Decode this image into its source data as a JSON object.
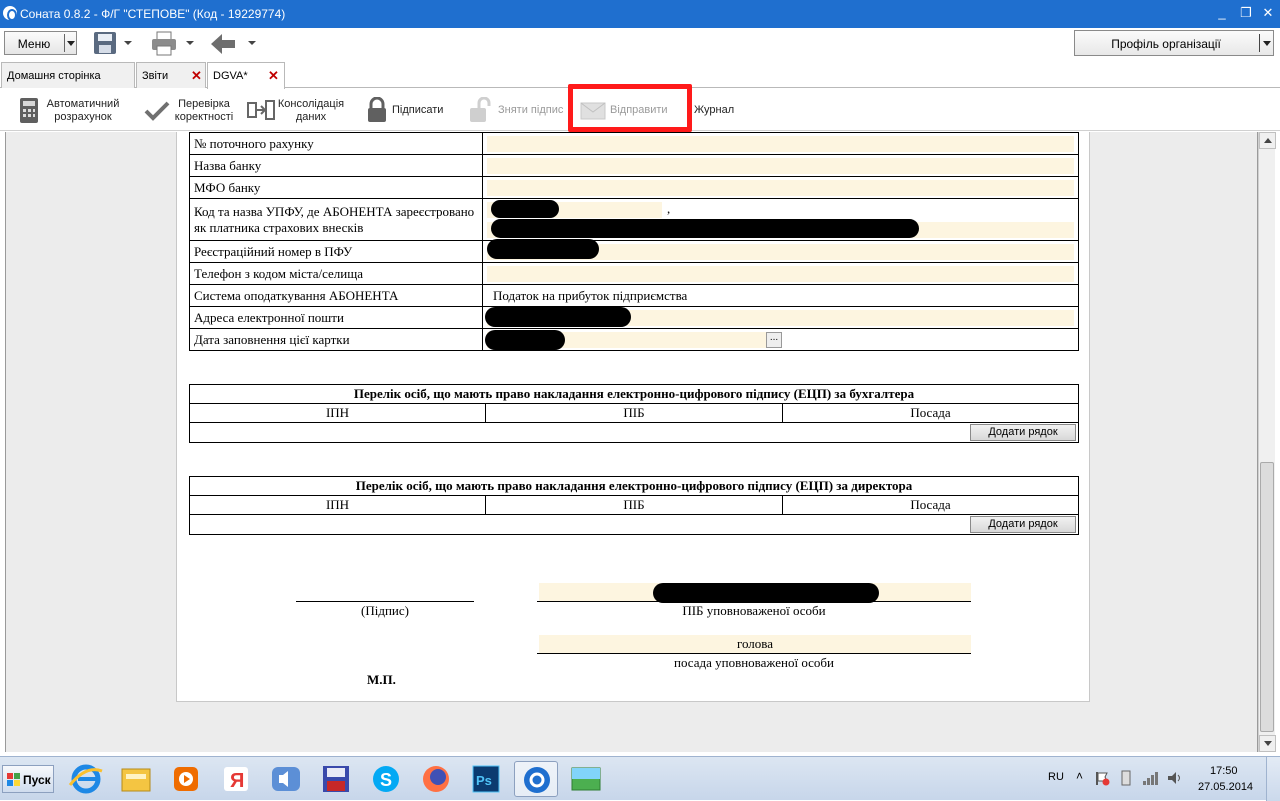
{
  "window": {
    "title": "Соната 0.8.2 - Ф/Г \"СТЕПОВЕ\" (Код - 19229774)",
    "minimize": "_",
    "restore": "❐",
    "close": "✕"
  },
  "toolbar": {
    "menu_label": "Меню",
    "profile_label": "Профіль організації"
  },
  "tabs": [
    {
      "label": "Домашня сторінка"
    },
    {
      "label": "Звіти",
      "close": "✕"
    },
    {
      "label": "DGVA*",
      "close": "✕"
    }
  ],
  "actions": {
    "auto_calc": [
      "Автоматичний",
      "розрахунок"
    ],
    "check": [
      "Перевірка",
      "коректності"
    ],
    "consolidation": [
      "Консолідація",
      "даних"
    ],
    "sign": "Підписати",
    "unsign": "Зняти підпис",
    "send": "Відправити",
    "journal": "Журнал"
  },
  "form": {
    "rows": [
      {
        "label": "№ поточного рахунку",
        "value": ""
      },
      {
        "label": "Назва банку",
        "value": ""
      },
      {
        "label": "МФО банку",
        "value": ""
      },
      {
        "label": "Код та назва УПФУ, де АБОНЕНТА зареєстровано як платника страхових внесків",
        "value": ","
      },
      {
        "label": "Реєстраційний номер в ПФУ",
        "value": ""
      },
      {
        "label": "Телефон з кодом міста/селища",
        "value": ""
      },
      {
        "label": "Система оподаткування АБОНЕНТА",
        "value": "Податок на прибуток підприємства"
      },
      {
        "label": "Адреса електронної пошти",
        "value": ""
      },
      {
        "label": "Дата заповнення цієї картки",
        "value": ""
      }
    ],
    "date_picker": "..."
  },
  "accountant_table": {
    "title": "Перелік осіб, що мають право накладання електронно-цифрового підпису (ЕЦП) за бухгалтера",
    "columns": [
      "ІПН",
      "ПІБ",
      "Посада"
    ],
    "add_row": "Додати рядок"
  },
  "director_table": {
    "title": "Перелік осіб, що мають право накладання електронно-цифрового підпису (ЕЦП) за директора",
    "columns": [
      "ІПН",
      "ПІБ",
      "Посада"
    ],
    "add_row": "Додати рядок"
  },
  "signature": {
    "signature_caption": "(Підпис)",
    "name_caption": "ПІБ уповноваженої особи",
    "position_value": "голова",
    "position_caption": "посада уповноваженої особи",
    "stamp": "М.П."
  },
  "taskbar": {
    "start": "Пуск",
    "language": "RU",
    "time": "17:50",
    "date": "27.05.2014"
  },
  "colors": {
    "titlebar": "#1f6fcf",
    "field_fill": "#fdf5e0",
    "highlight": "#ff1a1a"
  }
}
